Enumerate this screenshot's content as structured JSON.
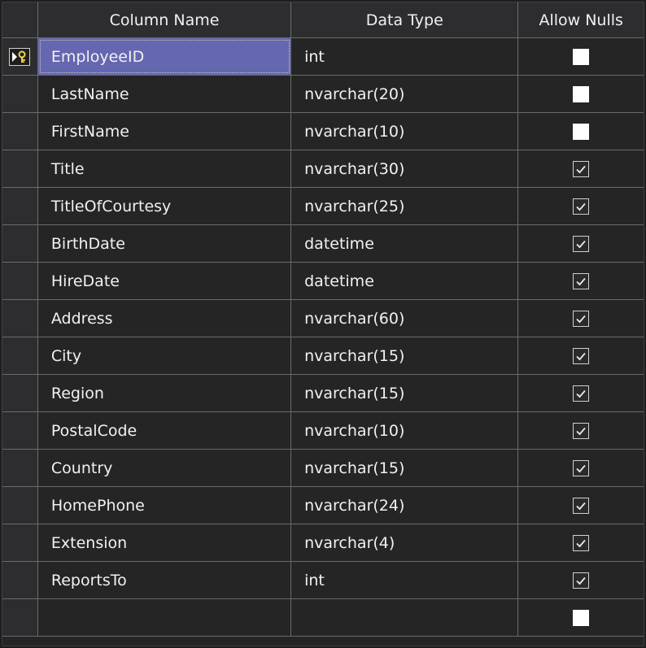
{
  "header": {
    "column_name": "Column Name",
    "data_type": "Data Type",
    "allow_nulls": "Allow Nulls"
  },
  "selected_row": 0,
  "rows": [
    {
      "name": "EmployeeID",
      "type": "int",
      "allow_nulls": false
    },
    {
      "name": "LastName",
      "type": "nvarchar(20)",
      "allow_nulls": false
    },
    {
      "name": "FirstName",
      "type": "nvarchar(10)",
      "allow_nulls": false
    },
    {
      "name": "Title",
      "type": "nvarchar(30)",
      "allow_nulls": true
    },
    {
      "name": "TitleOfCourtesy",
      "type": "nvarchar(25)",
      "allow_nulls": true
    },
    {
      "name": "BirthDate",
      "type": "datetime",
      "allow_nulls": true
    },
    {
      "name": "HireDate",
      "type": "datetime",
      "allow_nulls": true
    },
    {
      "name": "Address",
      "type": "nvarchar(60)",
      "allow_nulls": true
    },
    {
      "name": "City",
      "type": "nvarchar(15)",
      "allow_nulls": true
    },
    {
      "name": "Region",
      "type": "nvarchar(15)",
      "allow_nulls": true
    },
    {
      "name": "PostalCode",
      "type": "nvarchar(10)",
      "allow_nulls": true
    },
    {
      "name": "Country",
      "type": "nvarchar(15)",
      "allow_nulls": true
    },
    {
      "name": "HomePhone",
      "type": "nvarchar(24)",
      "allow_nulls": true
    },
    {
      "name": "Extension",
      "type": "nvarchar(4)",
      "allow_nulls": true
    },
    {
      "name": "ReportsTo",
      "type": "int",
      "allow_nulls": true
    },
    {
      "name": "",
      "type": "",
      "allow_nulls": false
    }
  ],
  "icons": {
    "row_indicator": "primary-key-current-row-icon",
    "checked": "checkmark-icon"
  },
  "colors": {
    "selection": "#6567b0",
    "background": "#252526",
    "gridline": "#6a6a6a",
    "text": "#f1f1f1"
  }
}
